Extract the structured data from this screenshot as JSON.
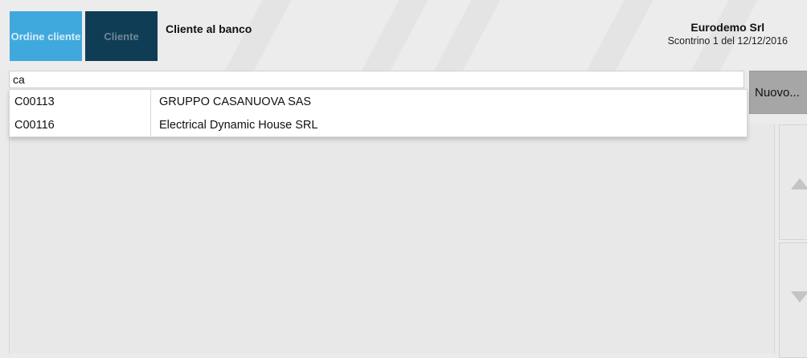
{
  "header": {
    "ordine_cliente_label": "Ordine cliente",
    "cliente_label": "Cliente",
    "cliente_al_banco": "Cliente al banco",
    "company_name": "Eurodemo Srl",
    "receipt_info": "Scontrino 1 del 12/12/2016"
  },
  "search": {
    "value": "ca"
  },
  "nuovo_button": {
    "label": "Nuovo..."
  },
  "suggestions": [
    {
      "code": "C00113",
      "name": "GRUPPO CASANUOVA SAS"
    },
    {
      "code": "C00116",
      "name": "Electrical Dynamic House SRL"
    }
  ],
  "icons": {
    "scroll_up": "triangle-up-icon",
    "scroll_down": "triangle-down-icon"
  },
  "colors": {
    "ordine_button": "#3fa9dd",
    "cliente_button": "#0f3d55",
    "nuovo_button": "#a6a6a6"
  }
}
